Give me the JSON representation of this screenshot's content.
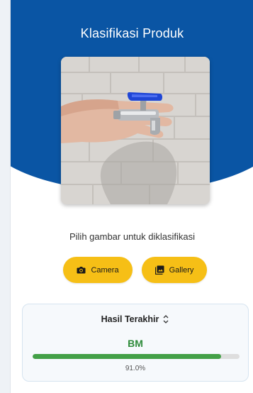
{
  "app": {
    "title": "Klasifikasi Produk",
    "brand_color": "#0a55a4",
    "accent_color": "#f6bf16"
  },
  "image_preview": {
    "content": "hand holding a chrome faucet valve with a blue handle against a white brick wall"
  },
  "prompt_text": "Pilih gambar untuk diklasifikasi",
  "actions": {
    "camera": {
      "label": "Camera",
      "icon": "camera-icon"
    },
    "gallery": {
      "label": "Gallery",
      "icon": "gallery-icon"
    }
  },
  "result": {
    "header": "Hasil Terakhir",
    "header_icon": "unfold-icon",
    "label": "BM",
    "confidence": 0.91,
    "confidence_text": "91.0%",
    "label_color": "#2e8b3a",
    "bar_color": "#43a047"
  }
}
